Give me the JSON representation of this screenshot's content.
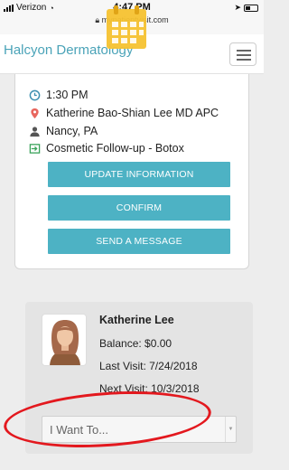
{
  "status_bar": {
    "carrier": "Verizon",
    "time": "4:47 PM",
    "url": "mypatientvisit.com"
  },
  "header": {
    "brand": "Halcyon Dermatology",
    "logo_icon": "calendar-icon",
    "menu_icon": "hamburger-menu-icon"
  },
  "appointment": {
    "time": "1:30 PM",
    "provider": "Katherine Bao-Shian Lee MD APC",
    "location": "Nancy, PA",
    "visit_type": "Cosmetic Follow-up - Botox",
    "buttons": {
      "update": "UPDATE INFORMATION",
      "confirm": "CONFIRM",
      "message": "SEND A MESSAGE"
    }
  },
  "patient": {
    "name": "Katherine Lee",
    "balance": "Balance: $0.00",
    "last_visit": "Last Visit: 7/24/2018",
    "next_visit": "Next Visit: 10/3/2018",
    "action_select": "I Want To..."
  },
  "colors": {
    "brand": "#4aa3b8",
    "button": "#4db2c4",
    "highlight_circle": "#e3181e"
  }
}
